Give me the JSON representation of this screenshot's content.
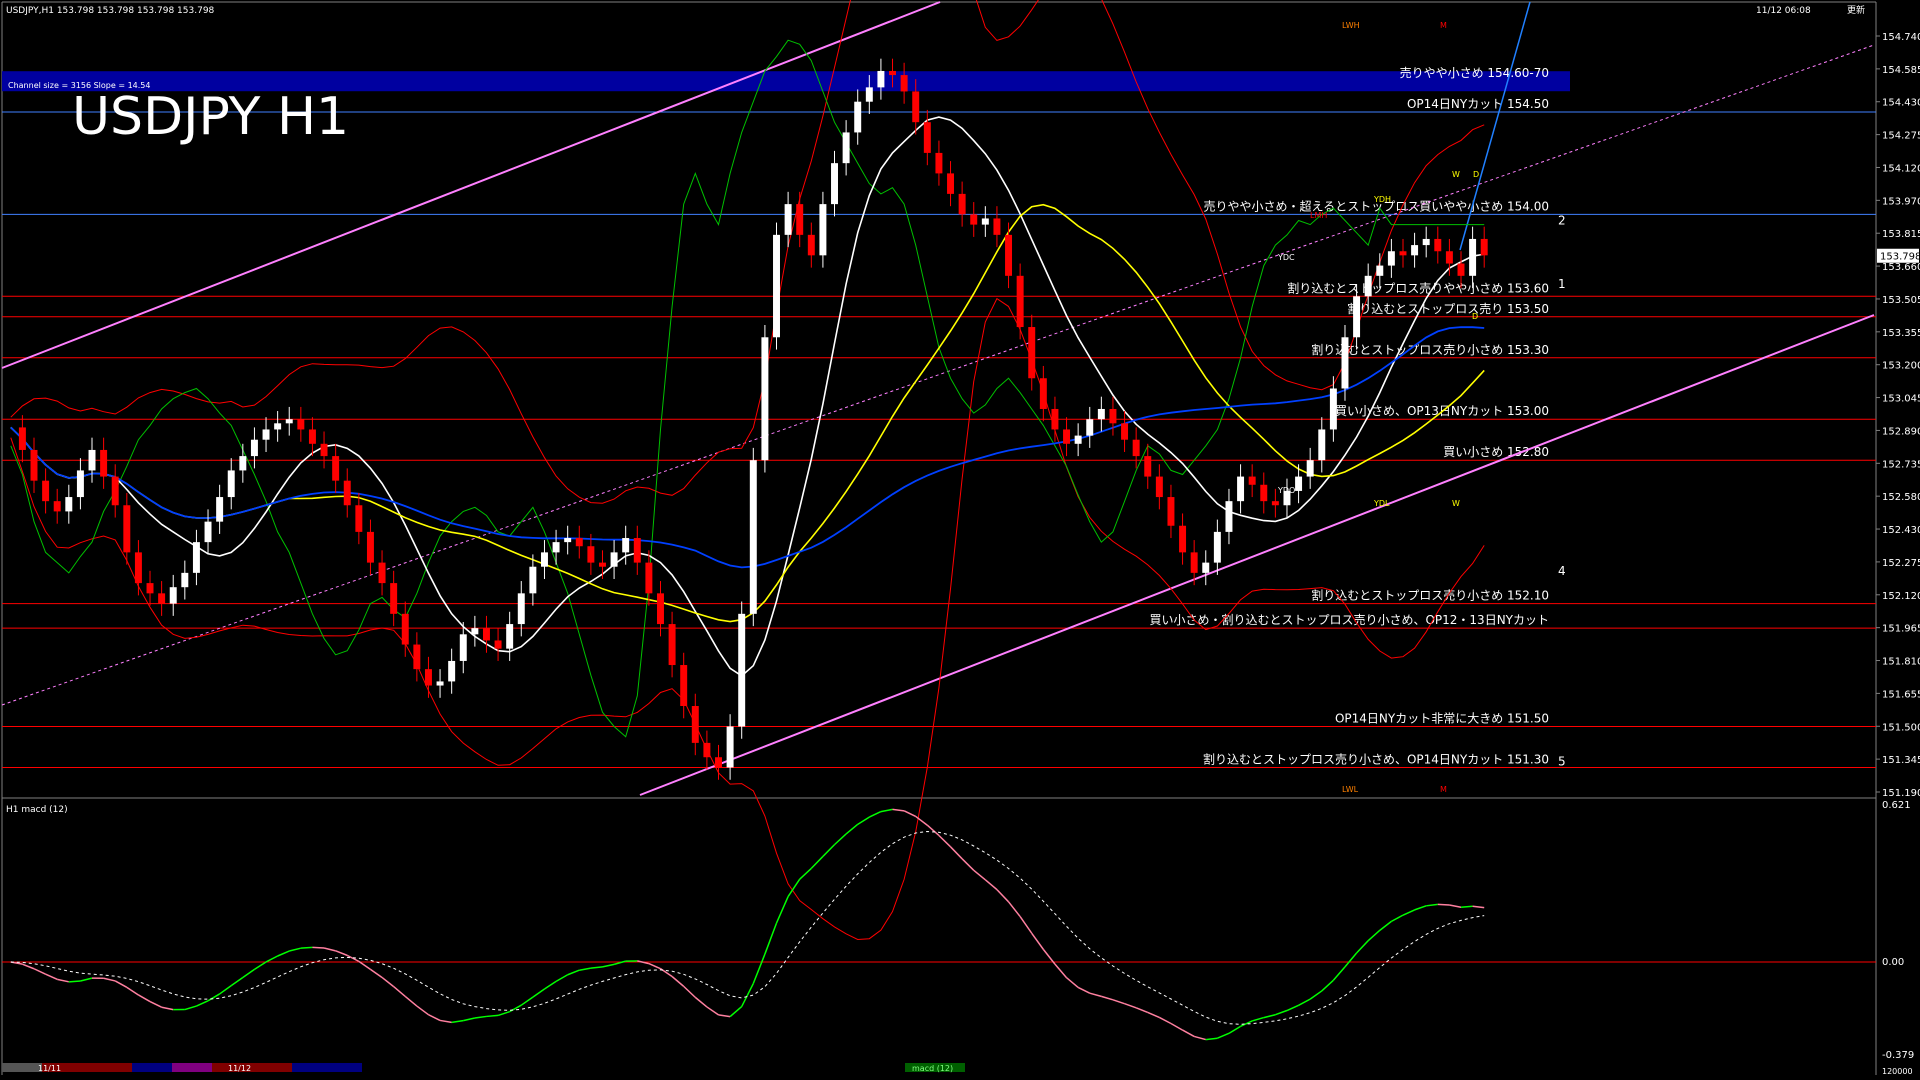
{
  "header": {
    "symbol_info": "USDJPY,H1  153.798 153.798 153.798 153.798",
    "chart_title": "USDJPY H1",
    "channel_info": "Channel size = 3156 Slope = 14.54",
    "datetime": "11/12 06:08",
    "update_label": "更新"
  },
  "indicator_panel": {
    "title": "H1  macd (12)",
    "y_top_label": "0.621",
    "y_zero_label": "0.00",
    "y_bottom_label": "-0.379",
    "macd_label": "macd (12)"
  },
  "bottom_bar": {
    "date_labels": [
      "11/11",
      "11/12"
    ],
    "bottom_value": "120000"
  },
  "colors": {
    "background": "#000000",
    "bull_candle": "#ffffff",
    "bear_candle": "#ff0000",
    "channel": "#ff80ff",
    "ma_fast": "#ffffff",
    "ma_mid": "#ffff00",
    "ma_slow": "#0040ff",
    "bollinger": "#ff0000",
    "chikou": "#00c000",
    "banner": "#0000a0",
    "macd_up": "#00ff00",
    "macd_down": "#ff80a0",
    "signal": "#ffffff"
  },
  "chart_data": {
    "type": "line",
    "title": "USDJPY H1",
    "ylim": [
      151.19,
      154.9
    ],
    "y_ticks": [
      "154.740",
      "154.585",
      "154.430",
      "154.275",
      "154.120",
      "153.970",
      "153.815",
      "153.660",
      "153.505",
      "153.355",
      "153.200",
      "153.045",
      "152.890",
      "152.735",
      "152.580",
      "152.430",
      "152.275",
      "152.120",
      "151.965",
      "151.810",
      "151.655",
      "151.500",
      "151.345",
      "151.190"
    ],
    "current_price": "153.798",
    "price_series": [
      152.96,
      152.85,
      152.7,
      152.6,
      152.55,
      152.62,
      152.75,
      152.85,
      152.72,
      152.58,
      152.35,
      152.2,
      152.15,
      152.1,
      152.18,
      152.25,
      152.4,
      152.5,
      152.62,
      152.75,
      152.82,
      152.9,
      152.95,
      152.98,
      153.0,
      152.95,
      152.88,
      152.82,
      152.7,
      152.58,
      152.45,
      152.3,
      152.2,
      152.05,
      151.9,
      151.78,
      151.7,
      151.72,
      151.82,
      151.95,
      151.98,
      151.92,
      151.88,
      152.0,
      152.15,
      152.28,
      152.35,
      152.4,
      152.42,
      152.38,
      152.3,
      152.28,
      152.35,
      152.42,
      152.3,
      152.15,
      152.0,
      151.8,
      151.6,
      151.42,
      151.35,
      151.3,
      151.5,
      152.05,
      152.8,
      153.4,
      153.9,
      154.05,
      153.9,
      153.8,
      154.05,
      154.25,
      154.4,
      154.55,
      154.62,
      154.7,
      154.68,
      154.6,
      154.45,
      154.3,
      154.2,
      154.1,
      154.0,
      153.95,
      153.98,
      153.9,
      153.7,
      153.45,
      153.2,
      153.05,
      152.95,
      152.88,
      152.92,
      153.0,
      153.05,
      152.98,
      152.9,
      152.82,
      152.72,
      152.62,
      152.48,
      152.35,
      152.25,
      152.3,
      152.45,
      152.6,
      152.72,
      152.68,
      152.6,
      152.58,
      152.65,
      152.72,
      152.8,
      152.95,
      153.15,
      153.4,
      153.6,
      153.7,
      153.75,
      153.82,
      153.8,
      153.85,
      153.88,
      153.82,
      153.76,
      153.7,
      153.88,
      153.8
    ],
    "levels": [
      {
        "price": 154.65,
        "label": "売りやや小さめ 154.60-70",
        "color": "#0000a0",
        "band": true
      },
      {
        "price": 154.5,
        "label": "OP14日NYカット 154.50",
        "color": "#4080ff"
      },
      {
        "price": 154.0,
        "label": "売りやや小さめ・超えるとストップロス買いやや小さめ 154.00",
        "color": "#4080ff"
      },
      {
        "price": 153.6,
        "label": "割り込むとストップロス売りやや小さめ 153.60",
        "color": "#ff0000"
      },
      {
        "price": 153.5,
        "label": "割り込むとストップロス売り 153.50",
        "color": "#ff0000"
      },
      {
        "price": 153.3,
        "label": "割り込むとストップロス売り小さめ 153.30",
        "color": "#ff0000"
      },
      {
        "price": 153.0,
        "label": "買い小さめ、OP13日NYカット 153.00",
        "color": "#ff0000"
      },
      {
        "price": 152.8,
        "label": "買い小さめ 152.80",
        "color": "#ff0000"
      },
      {
        "price": 152.1,
        "label": "割り込むとストップロス売り小さめ 152.10",
        "color": "#ff0000"
      },
      {
        "price": 151.98,
        "label": "買い小さめ・割り込むとストップロス売り小さめ、OP12・13日NYカット",
        "color": "#ff0000"
      },
      {
        "price": 151.5,
        "label": "OP14日NYカット非常に大きめ 151.50",
        "color": "#ff0000"
      },
      {
        "price": 151.3,
        "label": "割り込むとストップロス売り小さめ、OP14日NYカット 151.30",
        "color": "#ff0000"
      }
    ],
    "wave_labels": [
      "1",
      "2",
      "4",
      "5"
    ],
    "box_labels": [
      "LWH",
      "M",
      "YDH",
      "LMH",
      "YDC",
      "W",
      "D",
      "D",
      "YDO",
      "YDL",
      "W",
      "LWL",
      "M"
    ]
  }
}
